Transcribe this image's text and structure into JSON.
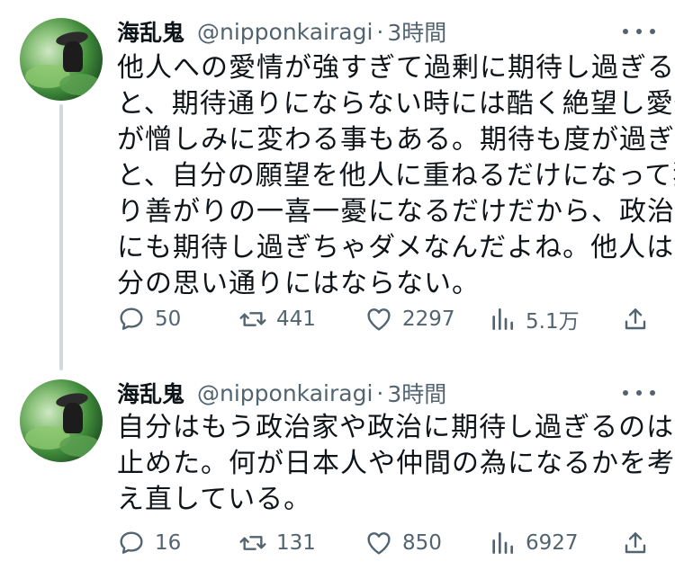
{
  "tweets": [
    {
      "name": "海乱鬼",
      "handle": "@nipponkairagi",
      "separator": "·",
      "time": "3時間",
      "lines": [
        "他人への愛情が強すぎて過剰に期待し過ぎる",
        "と、期待通りにならない時には酷く絶望し愛情",
        "が憎しみに変わる事もある。期待も度が過ぎる",
        "と、自分の願望を他人に重ねるだけになって独",
        "り善がりの一喜一憂になるだけだから、政治家",
        "にも期待し過ぎちゃダメなんだよね。他人は自",
        "分の思い通りにはならない。"
      ],
      "replies": "50",
      "retweets": "441",
      "likes": "2297",
      "views": "5.1万"
    },
    {
      "name": "海乱鬼",
      "handle": "@nipponkairagi",
      "separator": "·",
      "time": "3時間",
      "lines": [
        "自分はもう政治家や政治に期待し過ぎるのは",
        "止めた。何が日本人や仲間の為になるかを考",
        "え直している。"
      ],
      "replies": "16",
      "retweets": "131",
      "likes": "850",
      "views": "6927"
    }
  ],
  "icons": {
    "reply": "speech-bubble-icon",
    "retweet": "retweet-arrows-icon",
    "like": "heart-icon",
    "views": "bar-chart-icon",
    "share": "share-upload-icon",
    "more": "ellipsis-icon"
  },
  "colors": {
    "text": "#0f1419",
    "secondary": "#536471",
    "thread_line": "#cfd9de"
  }
}
